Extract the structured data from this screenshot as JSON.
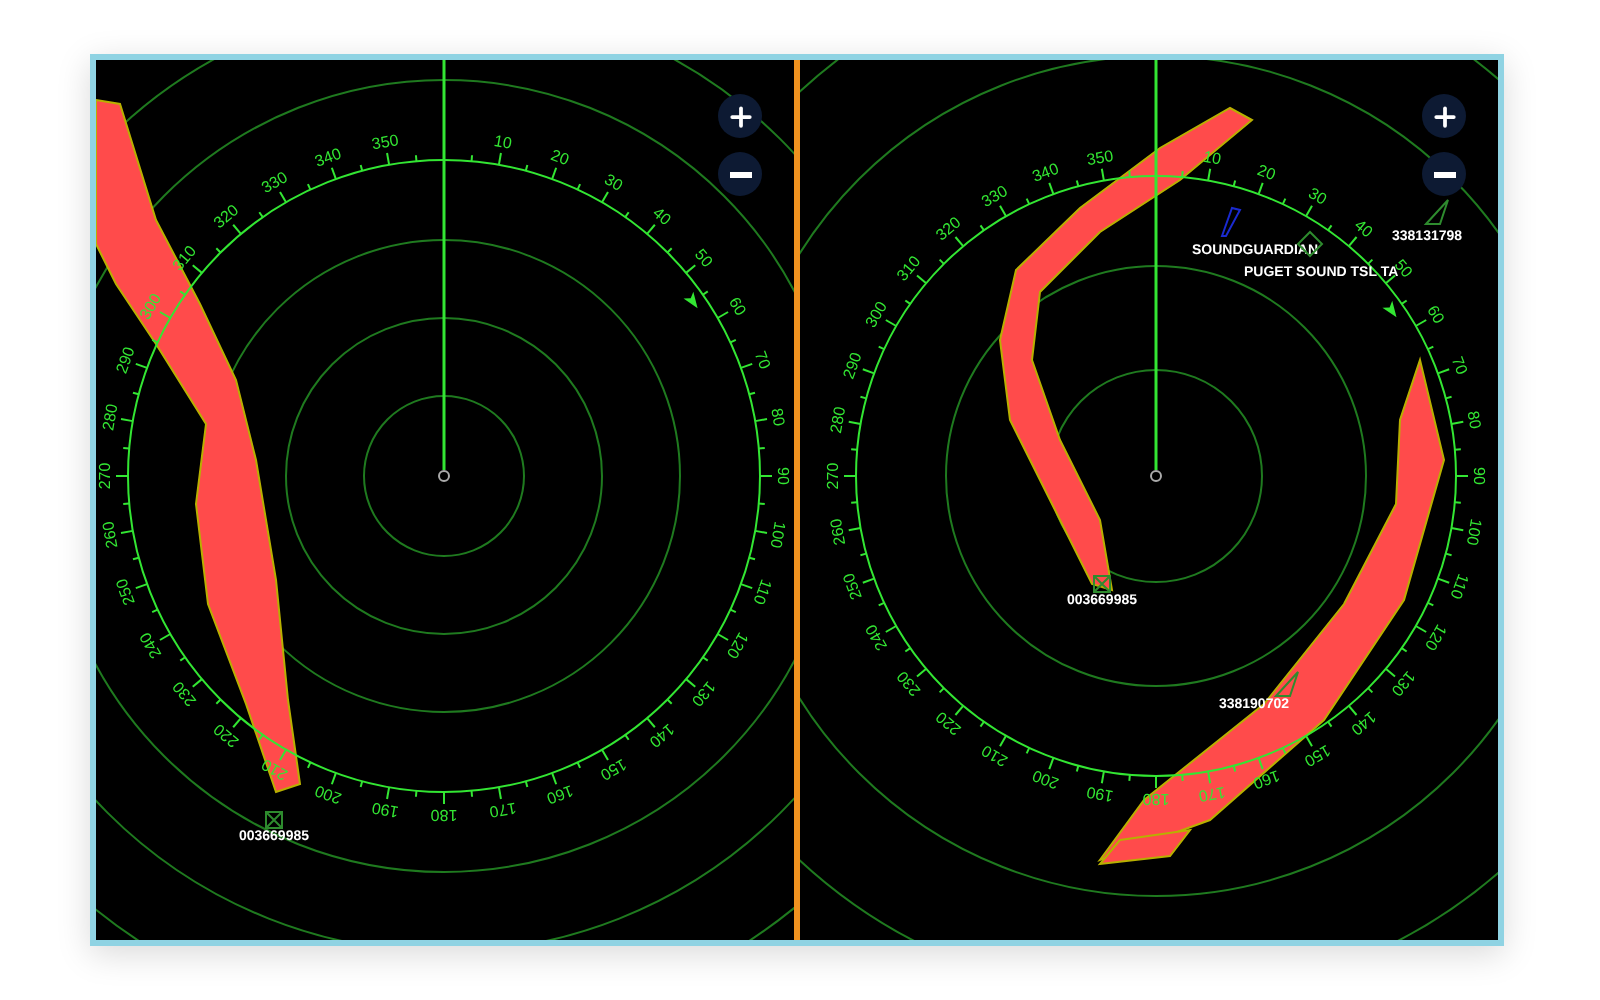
{
  "panels": [
    {
      "bearing_labels": [
        "10",
        "20",
        "30",
        "40",
        "50",
        "60",
        "70",
        "80",
        "90",
        "100",
        "110",
        "120",
        "130",
        "140",
        "150",
        "160",
        "170",
        "180",
        "190",
        "200",
        "210",
        "220",
        "230",
        "240",
        "250",
        "260",
        "270",
        "280",
        "290",
        "300",
        "310",
        "320",
        "330",
        "340",
        "350"
      ],
      "targets": [
        {
          "label": "003669985",
          "kind": "square"
        }
      ]
    },
    {
      "bearing_labels": [
        "10",
        "20",
        "30",
        "40",
        "50",
        "60",
        "70",
        "80",
        "90",
        "100",
        "110",
        "120",
        "130",
        "140",
        "150",
        "160",
        "170",
        "180",
        "190",
        "200",
        "210",
        "220",
        "230",
        "240",
        "250",
        "260",
        "270",
        "280",
        "290",
        "300",
        "310",
        "320",
        "330",
        "340",
        "350"
      ],
      "targets": [
        {
          "label": "SOUNDGUARDIAN",
          "kind": "wedge"
        },
        {
          "label": "PUGET SOUND TSL TA",
          "kind": "diamond"
        },
        {
          "label": "338131798",
          "kind": "triangle"
        },
        {
          "label": "003669985",
          "kind": "square"
        },
        {
          "label": "338190702",
          "kind": "triangle"
        }
      ]
    }
  ]
}
